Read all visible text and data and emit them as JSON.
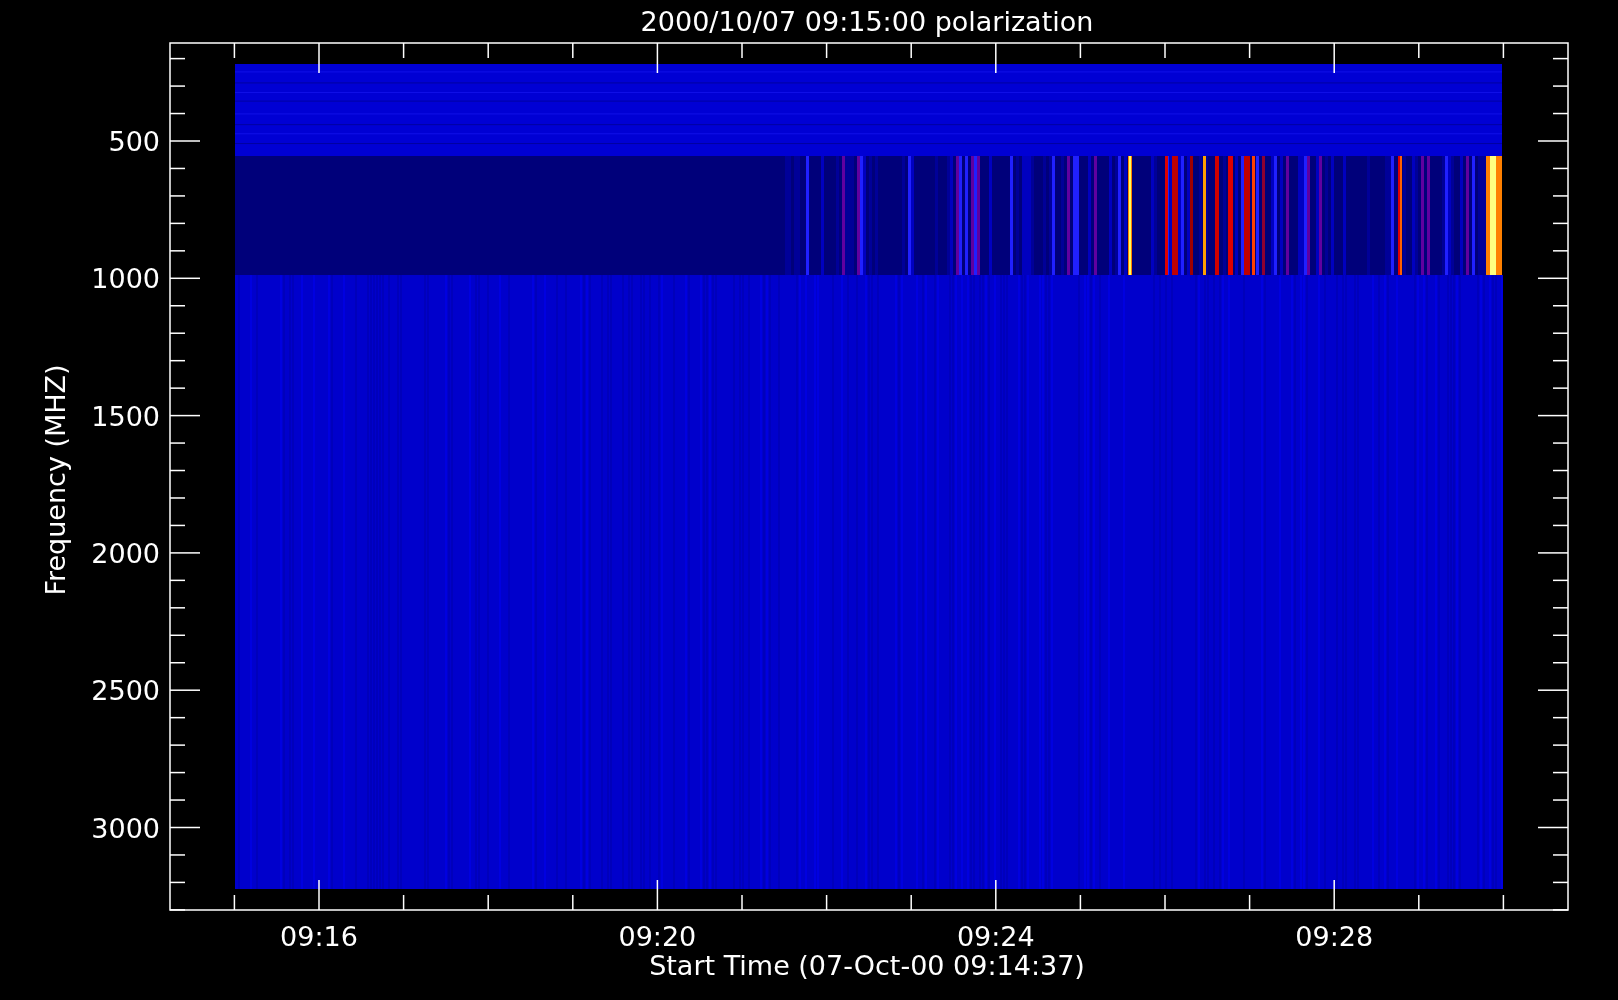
{
  "plot": {
    "title": "2000/10/07 09:15:00 polarization",
    "x_axis": {
      "label": "Start Time (07-Oct-00 09:14:37)",
      "ticks": [
        "09:16",
        "09:20",
        "09:24",
        "09:28"
      ]
    },
    "y_axis": {
      "label": "Frequency (MHZ)",
      "ticks": [
        "500",
        "1000",
        "1500",
        "2000",
        "2500",
        "3000"
      ]
    }
  }
}
